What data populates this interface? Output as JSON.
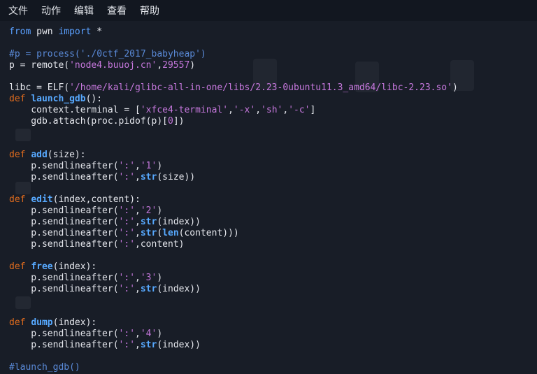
{
  "menubar": {
    "items": [
      "文件",
      "动作",
      "编辑",
      "查看",
      "帮助"
    ]
  },
  "code_lines": [
    [
      [
        "kw",
        "from"
      ],
      [
        "plain",
        " pwn "
      ],
      [
        "kw",
        "import"
      ],
      [
        "plain",
        " *"
      ]
    ],
    [],
    [
      [
        "comment",
        "#p = process('./0ctf_2017_babyheap')"
      ]
    ],
    [
      [
        "plain",
        "p = remote("
      ],
      [
        "str",
        "'node4.buuoj.cn'"
      ],
      [
        "plain",
        ","
      ],
      [
        "num",
        "29557"
      ],
      [
        "plain",
        ")"
      ]
    ],
    [],
    [
      [
        "plain",
        "libc = ELF("
      ],
      [
        "str",
        "'/home/kali/glibc-all-in-one/libs/2.23-0ubuntu11.3_amd64/libc-2.23.so'"
      ],
      [
        "plain",
        ")"
      ]
    ],
    [
      [
        "def",
        "def"
      ],
      [
        "plain",
        " "
      ],
      [
        "fn",
        "launch_gdb"
      ],
      [
        "plain",
        "():"
      ]
    ],
    [
      [
        "plain",
        "    context.terminal = ["
      ],
      [
        "str",
        "'xfce4-terminal'"
      ],
      [
        "plain",
        ","
      ],
      [
        "str",
        "'-x'"
      ],
      [
        "plain",
        ","
      ],
      [
        "str",
        "'sh'"
      ],
      [
        "plain",
        ","
      ],
      [
        "str",
        "'-c'"
      ],
      [
        "plain",
        "]"
      ]
    ],
    [
      [
        "plain",
        "    gdb.attach(proc.pidof(p)["
      ],
      [
        "num",
        "0"
      ],
      [
        "plain",
        "])"
      ]
    ],
    [],
    [],
    [
      [
        "def",
        "def"
      ],
      [
        "plain",
        " "
      ],
      [
        "fn",
        "add"
      ],
      [
        "plain",
        "(size):"
      ]
    ],
    [
      [
        "plain",
        "    p.sendlineafter("
      ],
      [
        "str",
        "':'"
      ],
      [
        "plain",
        ","
      ],
      [
        "str",
        "'1'"
      ],
      [
        "plain",
        ")"
      ]
    ],
    [
      [
        "plain",
        "    p.sendlineafter("
      ],
      [
        "str",
        "':'"
      ],
      [
        "plain",
        ","
      ],
      [
        "builtin",
        "str"
      ],
      [
        "plain",
        "(size))"
      ]
    ],
    [],
    [
      [
        "def",
        "def"
      ],
      [
        "plain",
        " "
      ],
      [
        "fn",
        "edit"
      ],
      [
        "plain",
        "(index,content):"
      ]
    ],
    [
      [
        "plain",
        "    p.sendlineafter("
      ],
      [
        "str",
        "':'"
      ],
      [
        "plain",
        ","
      ],
      [
        "str",
        "'2'"
      ],
      [
        "plain",
        ")"
      ]
    ],
    [
      [
        "plain",
        "    p.sendlineafter("
      ],
      [
        "str",
        "':'"
      ],
      [
        "plain",
        ","
      ],
      [
        "builtin",
        "str"
      ],
      [
        "plain",
        "(index))"
      ]
    ],
    [
      [
        "plain",
        "    p.sendlineafter("
      ],
      [
        "str",
        "':'"
      ],
      [
        "plain",
        ","
      ],
      [
        "builtin",
        "str"
      ],
      [
        "plain",
        "("
      ],
      [
        "builtin",
        "len"
      ],
      [
        "plain",
        "(content)))"
      ]
    ],
    [
      [
        "plain",
        "    p.sendlineafter("
      ],
      [
        "str",
        "':'"
      ],
      [
        "plain",
        ",content)"
      ]
    ],
    [],
    [
      [
        "def",
        "def"
      ],
      [
        "plain",
        " "
      ],
      [
        "fn",
        "free"
      ],
      [
        "plain",
        "(index):"
      ]
    ],
    [
      [
        "plain",
        "    p.sendlineafter("
      ],
      [
        "str",
        "':'"
      ],
      [
        "plain",
        ","
      ],
      [
        "str",
        "'3'"
      ],
      [
        "plain",
        ")"
      ]
    ],
    [
      [
        "plain",
        "    p.sendlineafter("
      ],
      [
        "str",
        "':'"
      ],
      [
        "plain",
        ","
      ],
      [
        "builtin",
        "str"
      ],
      [
        "plain",
        "(index))"
      ]
    ],
    [],
    [],
    [
      [
        "def",
        "def"
      ],
      [
        "plain",
        " "
      ],
      [
        "fn",
        "dump"
      ],
      [
        "plain",
        "(index):"
      ]
    ],
    [
      [
        "plain",
        "    p.sendlineafter("
      ],
      [
        "str",
        "':'"
      ],
      [
        "plain",
        ","
      ],
      [
        "str",
        "'4'"
      ],
      [
        "plain",
        ")"
      ]
    ],
    [
      [
        "plain",
        "    p.sendlineafter("
      ],
      [
        "str",
        "':'"
      ],
      [
        "plain",
        ","
      ],
      [
        "builtin",
        "str"
      ],
      [
        "plain",
        "(index))"
      ]
    ],
    [],
    [
      [
        "comment",
        "#launch_gdb()"
      ]
    ]
  ]
}
